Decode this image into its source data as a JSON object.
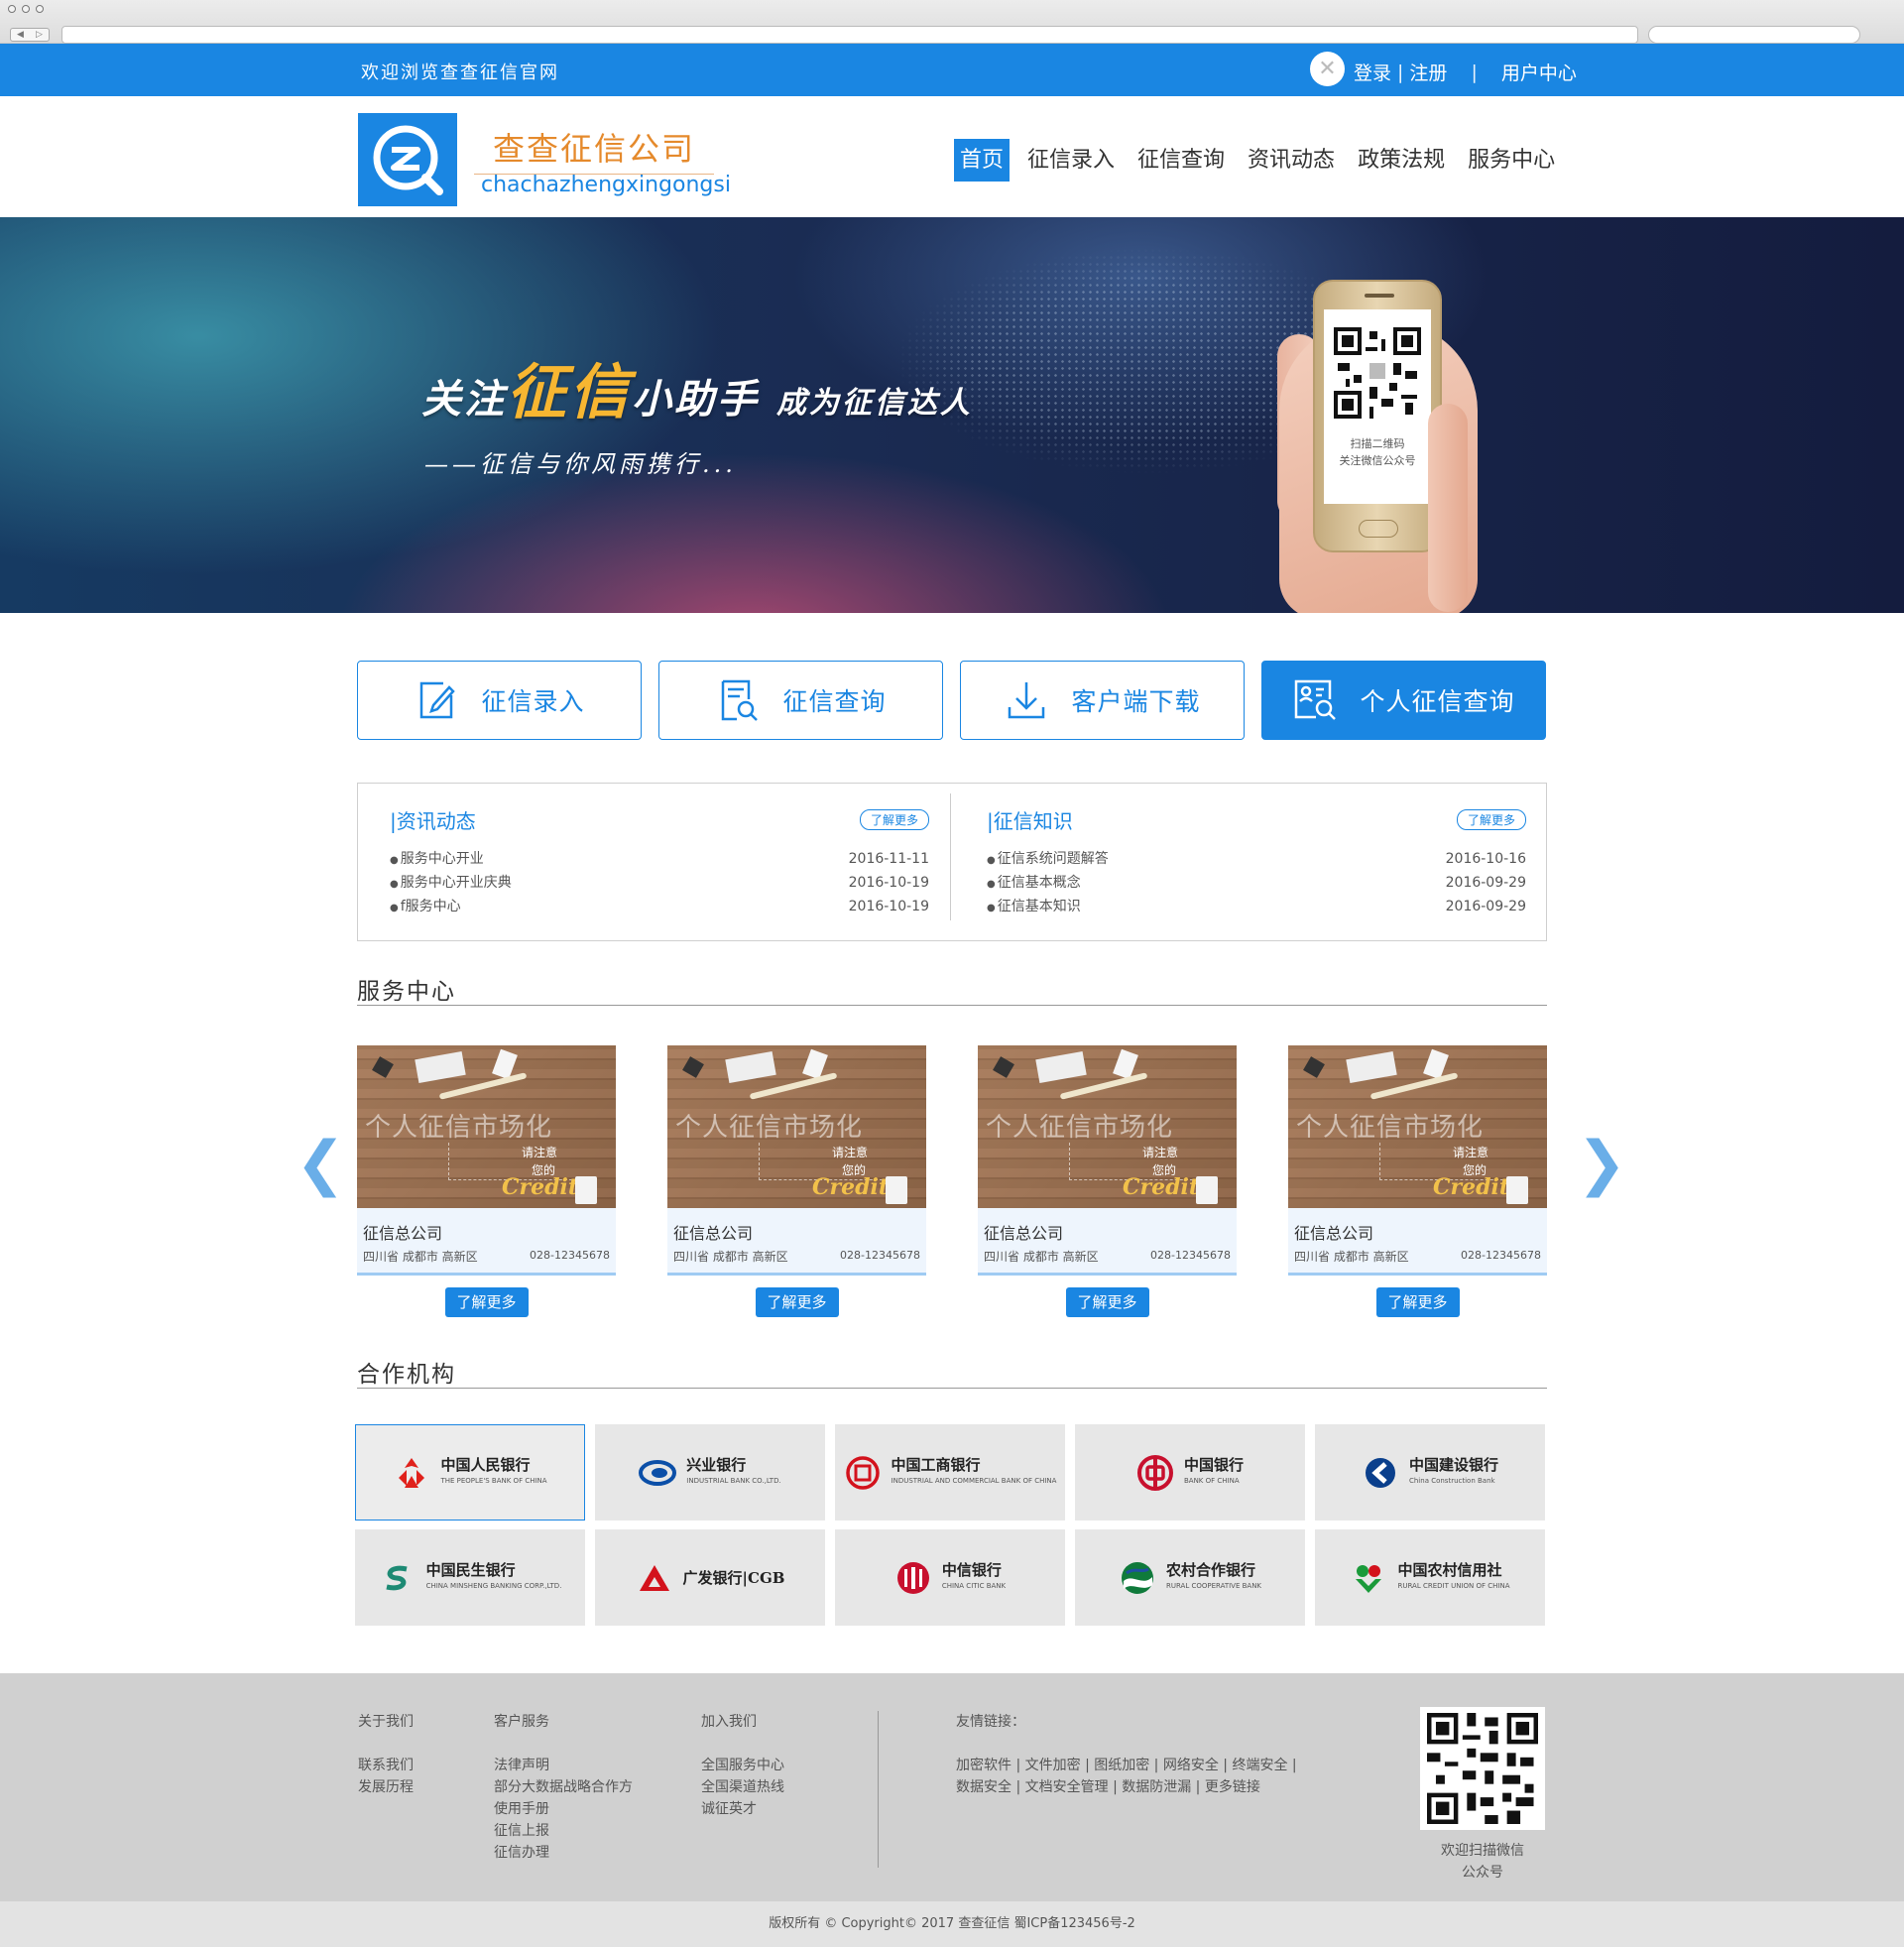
{
  "topbar": {
    "welcome": "欢迎浏览查查征信官网",
    "login": "登录",
    "register": "注册",
    "separator": "|",
    "user_center": "用户中心"
  },
  "header": {
    "logo_title": "查查征信公司",
    "logo_sub": "chachazhengxingongsi",
    "nav": [
      {
        "label": "首页",
        "active": true
      },
      {
        "label": "征信录入"
      },
      {
        "label": "征信查询"
      },
      {
        "label": "资讯动态"
      },
      {
        "label": "政策法规"
      },
      {
        "label": "服务中心"
      }
    ]
  },
  "banner": {
    "slogan_a": "关注",
    "slogan_b": "征信",
    "slogan_c": "小助手",
    "slogan_d": "成为征信达人",
    "sub": "——征信与你风雨携行...",
    "qr_line1": "扫描二维码",
    "qr_line2": "关注微信公众号"
  },
  "quick": [
    {
      "label": "征信录入",
      "icon": "edit-icon"
    },
    {
      "label": "征信查询",
      "icon": "document-search-icon"
    },
    {
      "label": "客户端下载",
      "icon": "download-icon"
    },
    {
      "label": "个人征信查询",
      "icon": "id-card-search-icon",
      "primary": true
    }
  ],
  "news": {
    "title": "|资讯动态",
    "more": "了解更多",
    "items": [
      {
        "text": "服务中心开业",
        "date": "2016-11-11"
      },
      {
        "text": "服务中心开业庆典",
        "date": "2016-10-19"
      },
      {
        "text": "f服务中心",
        "date": "2016-10-19"
      }
    ]
  },
  "knowledge": {
    "title": "|征信知识",
    "more": "了解更多",
    "items": [
      {
        "text": "征信系统问题解答",
        "date": "2016-10-16"
      },
      {
        "text": "征信基本概念",
        "date": "2016-09-29"
      },
      {
        "text": "征信基本知识",
        "date": "2016-09-29"
      }
    ]
  },
  "service": {
    "title": "服务中心",
    "prev": "❮",
    "next": "❯",
    "cards": [
      {
        "image_text": "个人征信市场化",
        "note1": "请注意",
        "note2": "您的",
        "credit": "Credit",
        "name": "征信总公司",
        "addr": "四川省 成都市 高新区",
        "tel": "028-12345678",
        "button": "了解更多"
      },
      {
        "image_text": "个人征信市场化",
        "note1": "请注意",
        "note2": "您的",
        "credit": "Credit",
        "name": "征信总公司",
        "addr": "四川省 成都市 高新区",
        "tel": "028-12345678",
        "button": "了解更多"
      },
      {
        "image_text": "个人征信市场化",
        "note1": "请注意",
        "note2": "您的",
        "credit": "Credit",
        "name": "征信总公司",
        "addr": "四川省 成都市 高新区",
        "tel": "028-12345678",
        "button": "了解更多"
      },
      {
        "image_text": "个人征信市场化",
        "note1": "请注意",
        "note2": "您的",
        "credit": "Credit",
        "name": "征信总公司",
        "addr": "四川省 成都市 高新区",
        "tel": "028-12345678",
        "button": "了解更多"
      }
    ]
  },
  "partners": {
    "title": "合作机构",
    "row1": [
      {
        "name": "中国人民银行",
        "en": "THE PEOPLE'S BANK OF CHINA",
        "color": "#e0211b",
        "icon": "pboc-logo-icon"
      },
      {
        "name": "兴业银行",
        "en": "INDUSTRIAL BANK CO.,LTD.",
        "color": "#0b4fa8",
        "icon": "cib-logo-icon"
      },
      {
        "name": "中国工商银行",
        "en": "INDUSTRIAL AND COMMERCIAL BANK OF CHINA",
        "color": "#d3121c",
        "icon": "icbc-logo-icon"
      },
      {
        "name": "中国银行",
        "en": "BANK OF CHINA",
        "color": "#c8102e",
        "icon": "boc-logo-icon"
      },
      {
        "name": "中国建设银行",
        "en": "China Construction Bank",
        "color": "#0a3f8c",
        "icon": "ccb-logo-icon"
      }
    ],
    "row2": [
      {
        "name": "中国民生银行",
        "en": "CHINA MINSHENG BANKING CORP.,LTD.",
        "color": "#1d8a74",
        "icon": "cmbc-logo-icon"
      },
      {
        "name": "广发银行|CGB",
        "en": "",
        "color": "#d3121c",
        "icon": "cgb-logo-icon"
      },
      {
        "name": "中信银行",
        "en": "CHINA CITIC BANK",
        "color": "#c8102e",
        "icon": "citic-logo-icon"
      },
      {
        "name": "农村合作银行",
        "en": "RURAL COOPERATIVE BANK",
        "color": "#0f7a3b",
        "icon": "rcb-logo-icon"
      },
      {
        "name": "中国农村信用社",
        "en": "RURAL CREDIT UNION OF CHINA",
        "color": "#1a9a3a",
        "icon": "rcu-logo-icon"
      }
    ]
  },
  "footer": {
    "col1": {
      "head": "关于我们",
      "items": [
        "联系我们",
        "发展历程"
      ]
    },
    "col2": {
      "head": "客户服务",
      "items": [
        "法律声明",
        "部分大数据战略合作方",
        "使用手册",
        "征信上报",
        "征信办理"
      ]
    },
    "col3": {
      "head": "加入我们",
      "items": [
        "全国服务中心",
        "全国渠道热线",
        "诚征英才"
      ]
    },
    "links_head": "友情链接：",
    "links_line1": "加密软件 | 文件加密 | 图纸加密 | 网络安全 | 终端安全 |",
    "links_line2": "数据安全 | 文档安全管理 | 数据防泄漏 | 更多链接",
    "qr_line1": "欢迎扫描微信",
    "qr_line2": "公众号",
    "copyright": "版权所有 © Copyright© 2017 查查征信 蜀ICP备123456号-2"
  },
  "colors": {
    "primary": "#1a86e2",
    "accent": "#e58a2c",
    "highlight": "#f7b631"
  }
}
